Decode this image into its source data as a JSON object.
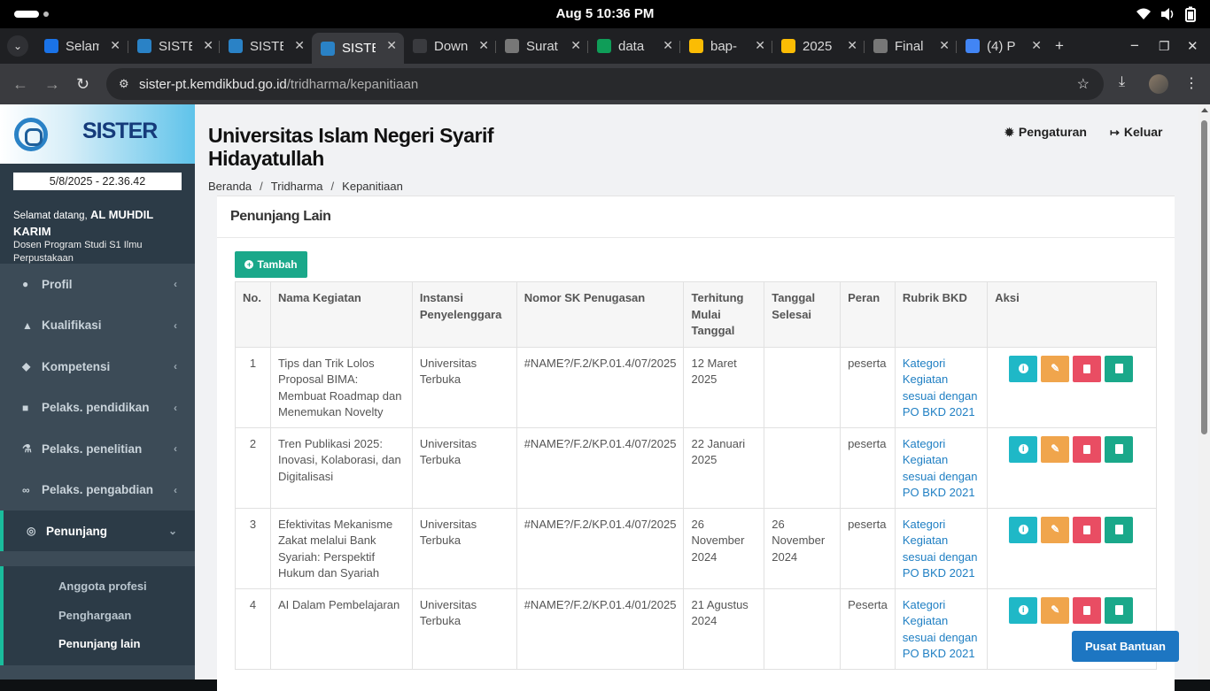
{
  "os": {
    "clock": "Aug 5  10:36 PM"
  },
  "tabs": [
    {
      "label": "Selamat",
      "fav_color": "#1a73e8"
    },
    {
      "label": "SISTER",
      "fav_color": "#2a82c6"
    },
    {
      "label": "SISTER",
      "fav_color": "#2a82c6"
    },
    {
      "label": "SISTER",
      "fav_color": "#2a82c6",
      "active": true
    },
    {
      "label": "Download",
      "fav_color": "#3a3b3f"
    },
    {
      "label": "Surat",
      "fav_color": "#777777"
    },
    {
      "label": "data",
      "fav_color": "#0f9d58"
    },
    {
      "label": "bap-",
      "fav_color": "#fbbc04"
    },
    {
      "label": "2025",
      "fav_color": "#fbbc04"
    },
    {
      "label": "Final",
      "fav_color": "#777777"
    },
    {
      "label": "(4) P",
      "fav_color": "#4285f4"
    }
  ],
  "address": {
    "host": "sister-pt.kemdikbud.go.id",
    "path": "/tridharma/kepanitiaan"
  },
  "sidebar": {
    "brand": "SISTER",
    "clock": "5/8/2025 - 22.36.42",
    "welcome_prefix": "Selamat datang,",
    "user_name": "AL MUHDIL KARIM",
    "role": "Dosen Program Studi S1 Ilmu Perpustakaan",
    "menu": [
      {
        "label": "Profil",
        "icon": "user-icon"
      },
      {
        "label": "Kualifikasi",
        "icon": "graduation-cap-icon"
      },
      {
        "label": "Kompetensi",
        "icon": "cubes-icon"
      },
      {
        "label": "Pelaks. pendidikan",
        "icon": "book-icon"
      },
      {
        "label": "Pelaks. penelitian",
        "icon": "flask-icon"
      },
      {
        "label": "Pelaks. pengabdian",
        "icon": "link-icon"
      },
      {
        "label": "Penunjang",
        "icon": "life-ring-icon",
        "open": true
      }
    ],
    "submenu": [
      "Anggota profesi",
      "Penghargaan",
      "Penunjang lain"
    ]
  },
  "header": {
    "title": "Universitas Islam Negeri Syarif Hidayatullah",
    "settings": "Pengaturan",
    "logout": "Keluar"
  },
  "breadcrumb": [
    "Beranda",
    "Tridharma",
    "Kepanitiaan"
  ],
  "card": {
    "title": "Penunjang Lain",
    "add_button": "Tambah",
    "columns": [
      "No.",
      "Nama Kegiatan",
      "Instansi Penyelenggara",
      "Nomor SK Penugasan",
      "Terhitung Mulai Tanggal",
      "Tanggal Selesai",
      "Peran",
      "Rubrik BKD",
      "Aksi"
    ],
    "rows": [
      {
        "no": "1",
        "nama": "Tips dan Trik Lolos Proposal BIMA: Membuat Roadmap dan Menemukan Novelty",
        "instansi": "Universitas Terbuka",
        "sk": "#NAME?/F.2/KP.01.4/07/2025",
        "mulai": "12 Maret 2025",
        "selesai": "",
        "peran": "peserta",
        "rubrik": "Kategori Kegiatan sesuai dengan PO BKD 2021"
      },
      {
        "no": "2",
        "nama": "Tren Publikasi 2025: Inovasi, Kolaborasi, dan Digitalisasi",
        "instansi": "Universitas Terbuka",
        "sk": "#NAME?/F.2/KP.01.4/07/2025",
        "mulai": "22 Januari 2025",
        "selesai": "",
        "peran": "peserta",
        "rubrik": "Kategori Kegiatan sesuai dengan PO BKD 2021"
      },
      {
        "no": "3",
        "nama": "Efektivitas Mekanisme Zakat melalui Bank Syariah: Perspektif Hukum dan Syariah",
        "instansi": "Universitas Terbuka",
        "sk": "#NAME?/F.2/KP.01.4/07/2025",
        "mulai": "26 November 2024",
        "selesai": "26 November 2024",
        "peran": "peserta",
        "rubrik": "Kategori Kegiatan sesuai dengan PO BKD 2021"
      },
      {
        "no": "4",
        "nama": "AI Dalam Pembelajaran",
        "instansi": "Universitas Terbuka",
        "sk": "#NAME?/F.2/KP.01.4/01/2025",
        "mulai": "21 Agustus 2024",
        "selesai": "",
        "peran": "Peserta",
        "rubrik": "Kategori Kegiatan sesuai dengan PO BKD 2021"
      }
    ]
  },
  "help_button": "Pusat Bantuan"
}
